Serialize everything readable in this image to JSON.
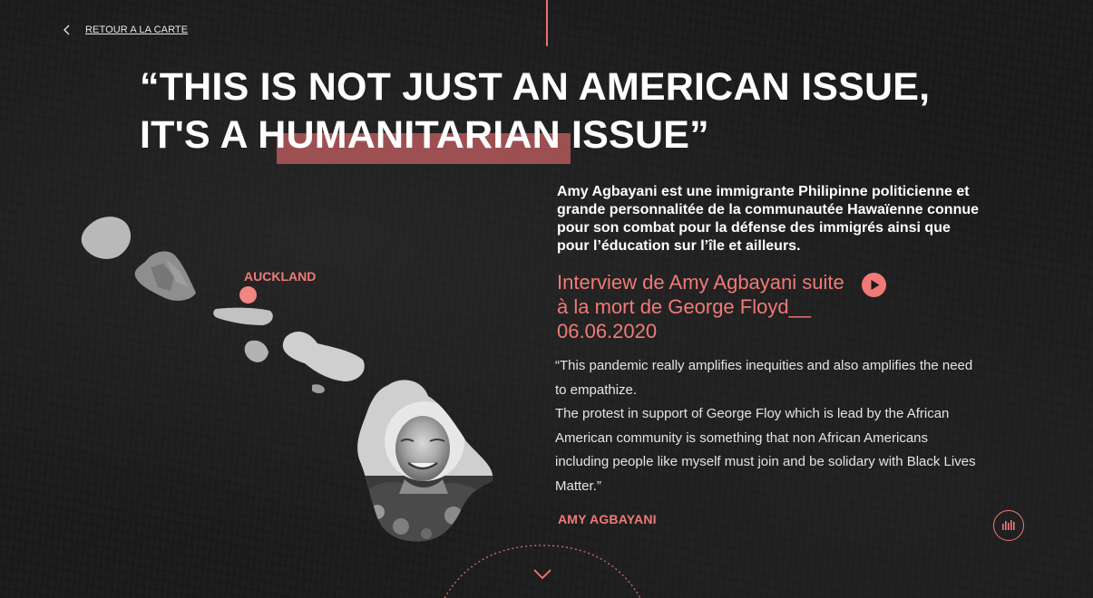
{
  "nav": {
    "back_label": "RETOUR A LA CARTE"
  },
  "headline": {
    "line1": "“THIS IS NOT JUST AN AMERICAN ISSUE,",
    "line2": "IT'S A HUMANITARIAN ISSUE”"
  },
  "map": {
    "location_label": "AUCKLAND"
  },
  "profile": {
    "bio": "Amy Agbayani est une immigrante Philipinne politicienne et grande personnalitée de la communautée Hawaïenne connue pour son combat pour la défense des immigrés ainsi que pour l’éducation sur l’île et ailleurs.",
    "interview_title": "Interview de Amy Agbayani suite à la mort de George Floyd__ 06.06.2020",
    "quote_p1": "“This pandemic really amplifies inequities and also amplifies the need to empathize.",
    "quote_p2": "The protest in support of George Floy which is lead by the African American community is something that non African Americans including people like myself must join and be solidary with Black Lives Matter.”",
    "author": "AMY AGBAYANI"
  },
  "icons": {
    "back": "chevron-left-icon",
    "play": "play-icon",
    "audio": "audio-bars-icon",
    "scroll": "chevron-down-icon"
  },
  "colors": {
    "accent": "#f07a78",
    "highlight_bar": "#b3585a",
    "background": "#1b1b1b",
    "text": "#ffffff"
  }
}
